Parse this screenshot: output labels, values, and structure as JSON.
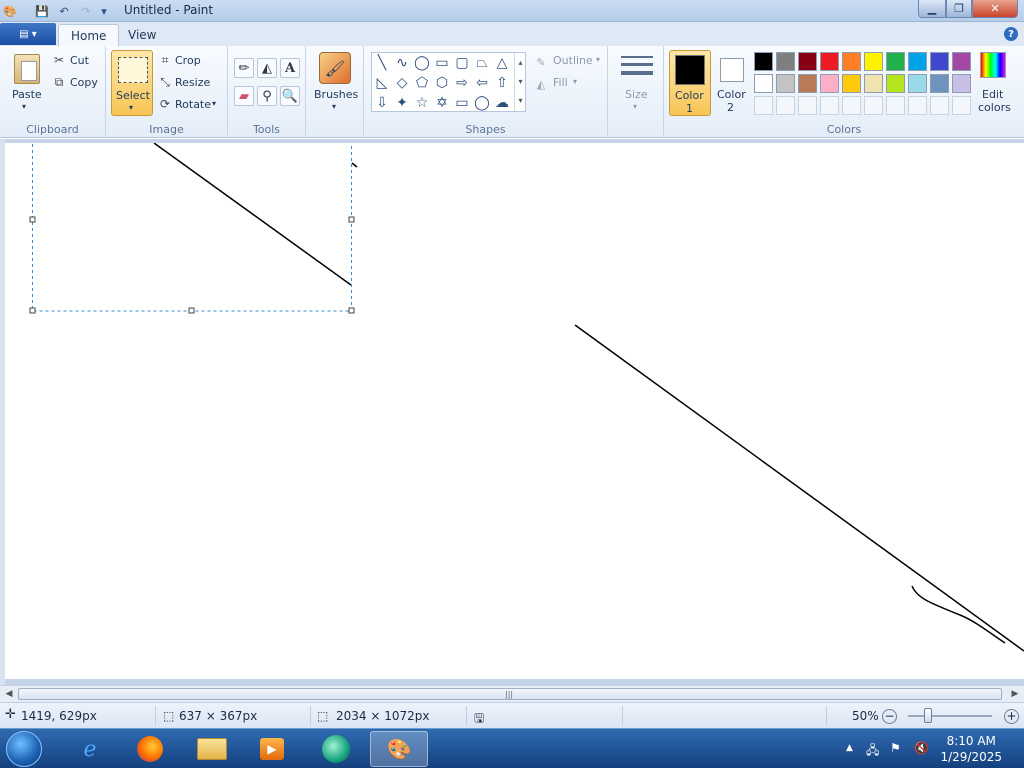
{
  "window": {
    "title": "Untitled - Paint"
  },
  "tabs": [
    {
      "label": "Home"
    },
    {
      "label": "View"
    }
  ],
  "clipboard": {
    "paste": "Paste",
    "cut": "Cut",
    "copy": "Copy",
    "group": "Clipboard"
  },
  "image": {
    "select": "Select",
    "crop": "Crop",
    "resize": "Resize",
    "rotate": "Rotate",
    "group": "Image"
  },
  "tools": {
    "group": "Tools",
    "text_glyph": "A"
  },
  "brushes": {
    "label": "Brushes"
  },
  "shapes": {
    "outline": "Outline",
    "fill": "Fill",
    "group": "Shapes"
  },
  "size": {
    "label": "Size"
  },
  "colors": {
    "color1_line1": "Color",
    "color1_line2": "1",
    "color2_line1": "Color",
    "color2_line2": "2",
    "edit_line1": "Edit",
    "edit_line2": "colors",
    "group": "Colors",
    "color1_value": "#000000",
    "color2_value": "#ffffff",
    "row1": [
      "#000000",
      "#7f7f7f",
      "#880015",
      "#ed1c24",
      "#ff7f27",
      "#fff200",
      "#22b14c",
      "#00a2e8",
      "#3f48cc",
      "#a349a4"
    ],
    "row2": [
      "#ffffff",
      "#c3c3c3",
      "#b97a57",
      "#ffaec9",
      "#ffc90e",
      "#efe4b0",
      "#b5e61d",
      "#99d9ea",
      "#7092be",
      "#c8bfe7"
    ]
  },
  "status": {
    "cursor": "1419, 629px",
    "selection": "637 × 367px",
    "canvas_size": "2034 × 1072px",
    "zoom": "50%"
  },
  "clock": {
    "time": "8:10 AM",
    "date": "1/29/2025"
  }
}
